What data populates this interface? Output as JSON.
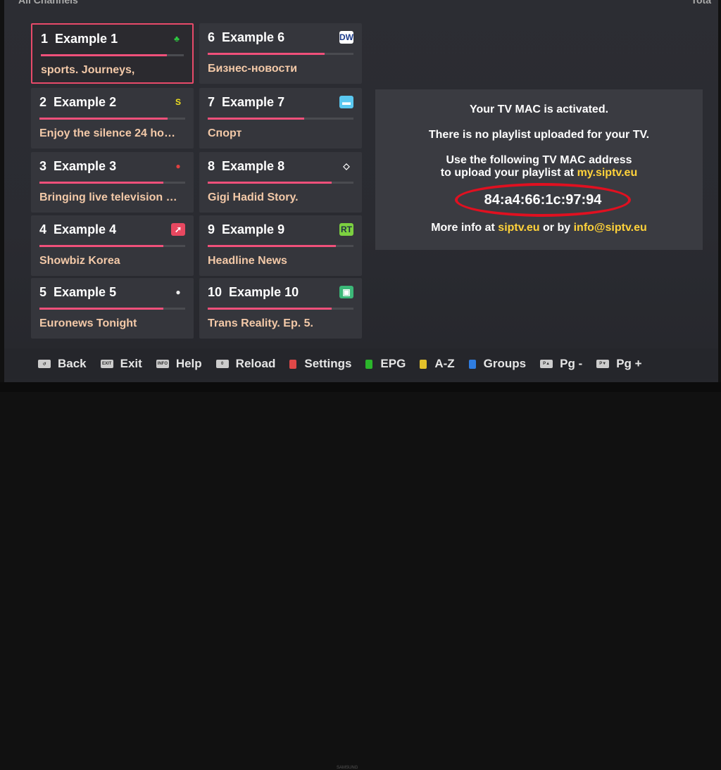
{
  "header": {
    "title": "All Channels",
    "right": "Tota"
  },
  "channels": [
    {
      "num": "1",
      "name": "Example 1",
      "desc": "sports.              Journeys,",
      "progress": 88,
      "logo": "green-figure",
      "selected": true
    },
    {
      "num": "2",
      "name": "Example 2",
      "desc": "Enjoy the silence 24 ho…",
      "progress": 88,
      "logo": "Silence"
    },
    {
      "num": "3",
      "name": "Example 3",
      "desc": "Bringing live television …",
      "progress": 85,
      "logo": "red-round"
    },
    {
      "num": "4",
      "name": "Example 4",
      "desc": "Showbiz Korea",
      "progress": 85,
      "logo": "red-arrow"
    },
    {
      "num": "5",
      "name": "Example 5",
      "desc": "Euronews Tonight",
      "progress": 85,
      "logo": "white-circle"
    },
    {
      "num": "6",
      "name": "Example 6",
      "desc": "Бизнес-новости",
      "progress": 80,
      "logo": "DW"
    },
    {
      "num": "7",
      "name": "Example 7",
      "desc": "Спорт",
      "progress": 66,
      "logo": "blue-square"
    },
    {
      "num": "8",
      "name": "Example 8",
      "desc": "Gigi Hadid Story.",
      "progress": 85,
      "logo": "diamond"
    },
    {
      "num": "9",
      "name": "Example 9",
      "desc": "Headline News",
      "progress": 88,
      "logo": "RT"
    },
    {
      "num": "10",
      "name": "Example 10",
      "desc": "Trans Reality. Ep. 5.",
      "progress": 85,
      "logo": "green-tv"
    }
  ],
  "info": {
    "line1": "Your TV MAC is activated.",
    "line2": "There is no playlist uploaded for your TV.",
    "line3": "Use the following TV MAC address",
    "line4a": "to upload your playlist at ",
    "line4b": "my.siptv.eu",
    "mac": "84:a4:66:1c:97:94",
    "line5a": "More info at ",
    "line5b": "siptv.eu",
    "line5c": " or by ",
    "line5d": "info@siptv.eu"
  },
  "footer": [
    {
      "key": "↺",
      "label": "Back"
    },
    {
      "key": "EXIT",
      "label": "Exit"
    },
    {
      "key": "INFO",
      "label": "Help"
    },
    {
      "key": "0",
      "label": "Reload"
    },
    {
      "color": "#e04848",
      "label": "Settings"
    },
    {
      "color": "#2bb52b",
      "label": "EPG"
    },
    {
      "color": "#e3c12a",
      "label": "A-Z"
    },
    {
      "color": "#2f7de0",
      "label": "Groups"
    },
    {
      "key": "P▲",
      "label": "Pg -"
    },
    {
      "key": "P▼",
      "label": "Pg +"
    }
  ],
  "brand": "SAMSUNG",
  "colors": {
    "accent": "#f0507a",
    "highlight": "#ffd23a",
    "mac_circle": "#e01020"
  }
}
